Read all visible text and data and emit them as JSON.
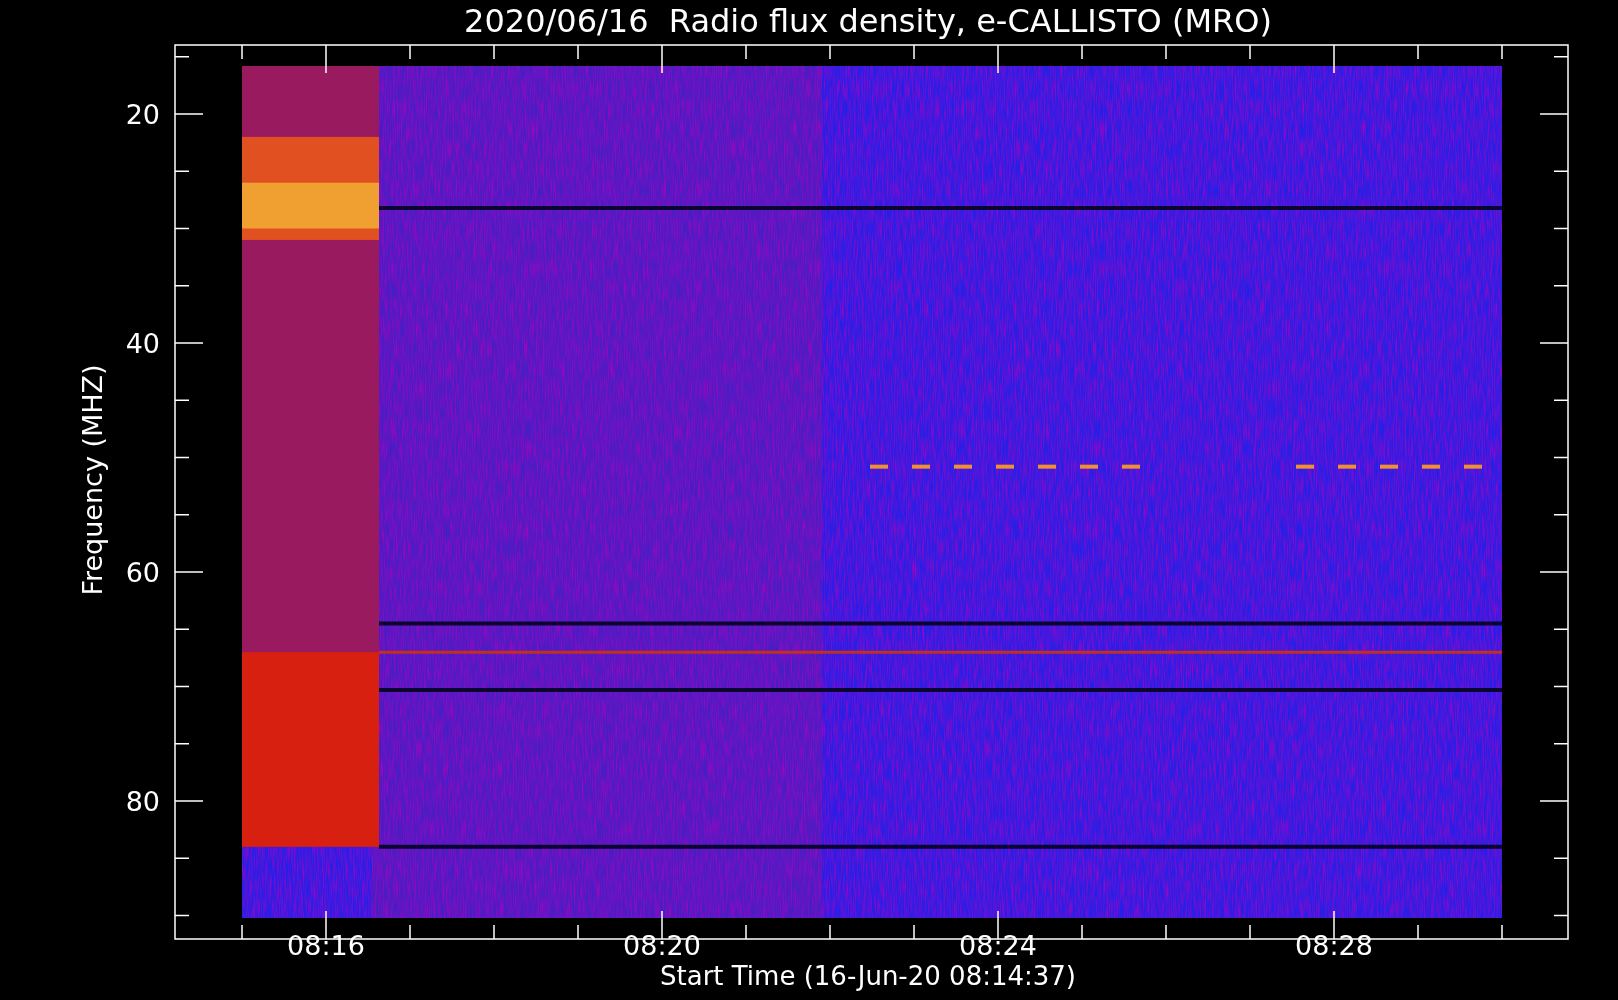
{
  "title": "2020/06/16  Radio flux density, e-CALLISTO (MRO)",
  "y_axis": {
    "label": "Frequency (MHZ)",
    "ticks": [
      "20",
      "40",
      "60",
      "80"
    ]
  },
  "x_axis": {
    "label": "Start Time (16-Jun-20 08:14:37)",
    "ticks": [
      "08:16",
      "08:20",
      "08:24",
      "08:28"
    ]
  }
}
